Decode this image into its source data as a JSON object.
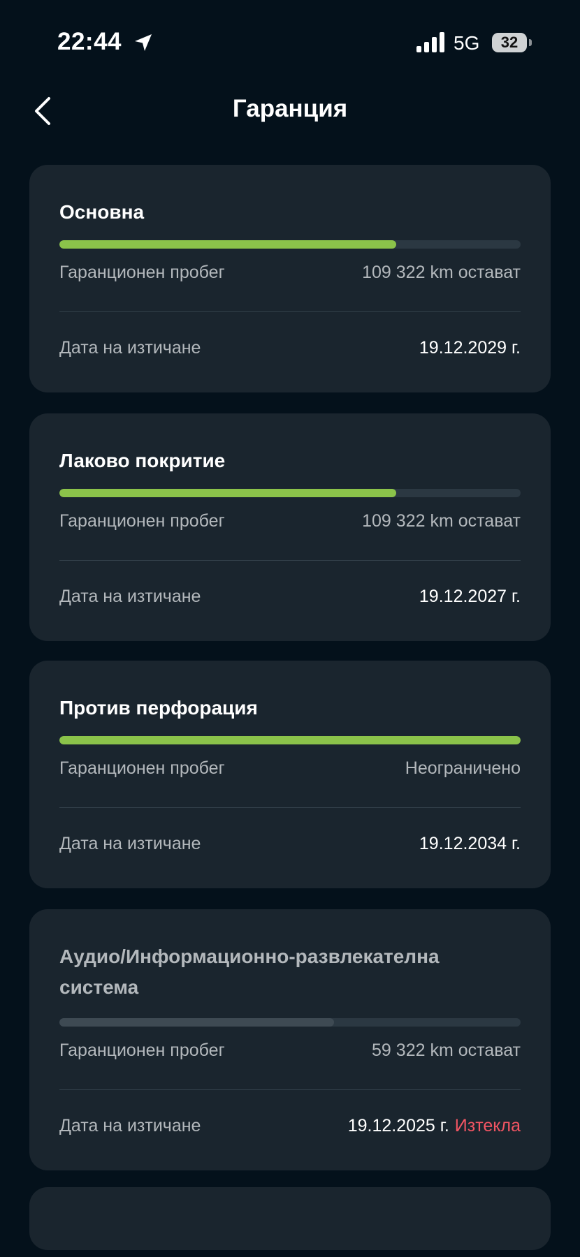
{
  "status_bar": {
    "time": "22:44",
    "network": "5G",
    "battery": "32",
    "location_icon": "location-arrow-icon",
    "signal_icon": "cellular-signal-icon"
  },
  "header": {
    "title": "Гаранция",
    "back_icon": "chevron-left-icon"
  },
  "colors": {
    "background": "#04111b",
    "card": "#1a252e",
    "progress_active": "#8bc34a",
    "expired": "#f25563"
  },
  "warranties": [
    {
      "title": "Основна",
      "progress_fraction": 0.73,
      "mileage_label": "Гаранционен пробег",
      "mileage_value": "109 322 km остават",
      "expiry_label": "Дата на изтичане",
      "expiry_value": "19.12.2029 г.",
      "status": ""
    },
    {
      "title": "Лаково покритие",
      "progress_fraction": 0.73,
      "mileage_label": "Гаранционен пробег",
      "mileage_value": "109 322 km остават",
      "expiry_label": "Дата на изтичане",
      "expiry_value": "19.12.2027 г.",
      "status": ""
    },
    {
      "title": "Против перфорация",
      "progress_fraction": 1.0,
      "mileage_label": "Гаранционен пробег",
      "mileage_value": "Неограничено",
      "expiry_label": "Дата на изтичане",
      "expiry_value": "19.12.2034 г.",
      "status": ""
    },
    {
      "title": "Аудио/Информационно-развлекателна система",
      "progress_fraction": 0.595,
      "mileage_label": "Гаранционен пробег",
      "mileage_value": "59 322 km остават",
      "expiry_label": "Дата на изтичане",
      "expiry_value": "19.12.2025 г.",
      "status": "Изтекла"
    }
  ]
}
